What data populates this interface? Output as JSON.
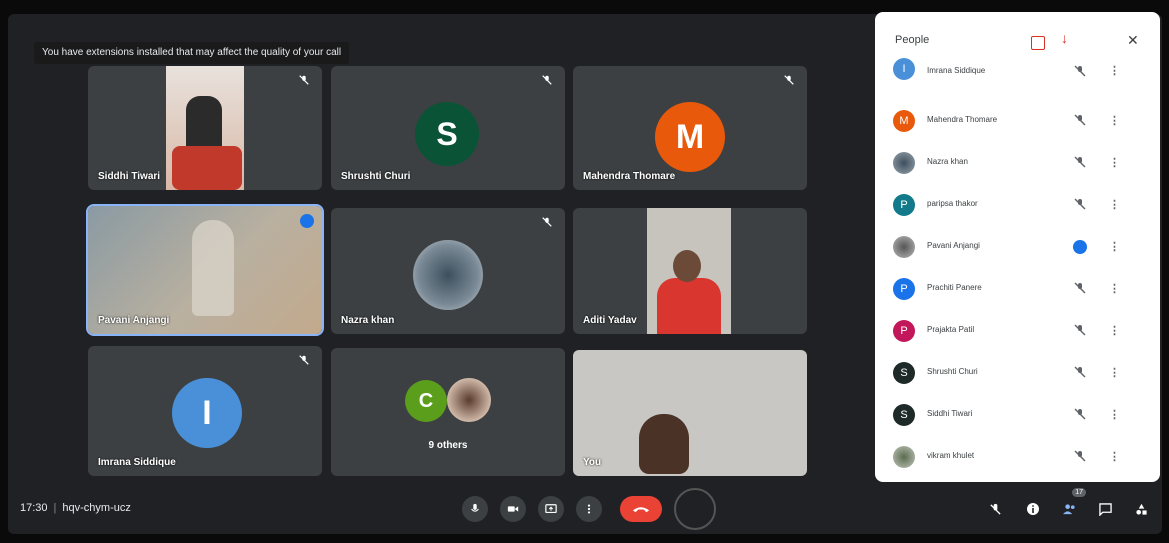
{
  "banner": "You have extensions installed that may affect the quality of your call",
  "tiles": {
    "siddhi": "Siddhi Tiwari",
    "shrushti": "Shrushti Churi",
    "shrushti_initial": "S",
    "mahendra": "Mahendra Thomare",
    "mahendra_initial": "M",
    "pavani": "Pavani Anjangi",
    "nazra": "Nazra khan",
    "aditi": "Aditi Yadav",
    "imrana": "Imrana Siddique",
    "imrana_initial": "I",
    "others_initial": "C",
    "others": "9 others",
    "you": "You"
  },
  "meeting": {
    "time": "17:30",
    "code": "hqv-chym-ucz"
  },
  "participant_count": "17",
  "people_panel": {
    "title": "People",
    "rows": [
      {
        "name": "Imrana Siddique",
        "initial": "I"
      },
      {
        "name": "Mahendra Thomare",
        "initial": "M"
      },
      {
        "name": "Nazra khan",
        "initial": ""
      },
      {
        "name": "paripsa thakor",
        "initial": "P"
      },
      {
        "name": "Pavani Anjangi",
        "initial": ""
      },
      {
        "name": "Prachiti Panere",
        "initial": "P"
      },
      {
        "name": "Prajakta Patil",
        "initial": "P"
      },
      {
        "name": "Shrushti Churi",
        "initial": "S"
      },
      {
        "name": "Siddhi Tiwari",
        "initial": "S"
      },
      {
        "name": "vikram khulet",
        "initial": ""
      }
    ]
  },
  "colors": {
    "accent": "#1a73e8",
    "end_call": "#ea4335",
    "avatar_shrushti": "#0b5337",
    "avatar_mahendra": "#e8590c",
    "avatar_imrana": "#4a90d9",
    "avatar_others": "#5a9e1b"
  }
}
